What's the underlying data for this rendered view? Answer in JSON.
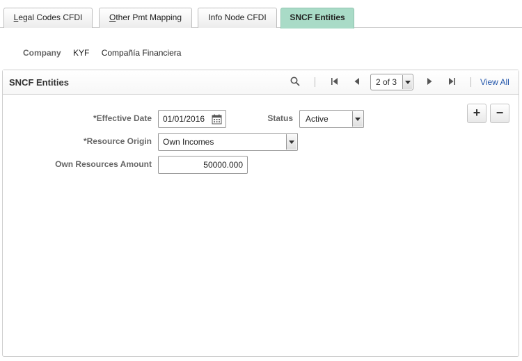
{
  "tabs": [
    {
      "label": "Legal Codes CFDI",
      "accesskey": "L",
      "rest": "egal Codes CFDI"
    },
    {
      "label": "Other Pmt Mapping",
      "accesskey": "O",
      "rest": "ther Pmt Mapping"
    },
    {
      "label": "Info Node CFDI"
    },
    {
      "label": "SNCF Entities",
      "active": true
    }
  ],
  "company": {
    "label": "Company",
    "code": "KYF",
    "name": "Compañía Financiera"
  },
  "group": {
    "title": "SNCF Entities",
    "pager": {
      "value": "2 of 3"
    },
    "view_all": "View All",
    "add_symbol": "+",
    "remove_symbol": "−"
  },
  "form": {
    "effective_date": {
      "label": "*Effective Date",
      "value": "01/01/2016"
    },
    "status": {
      "label": "Status",
      "value": "Active"
    },
    "resource_origin": {
      "label": "*Resource Origin",
      "value": "Own Incomes"
    },
    "own_resources_amount": {
      "label": "Own Resources Amount",
      "value": "50000.000"
    }
  },
  "colors": {
    "active_tab": "#a9dbc7",
    "link": "#2255aa"
  }
}
